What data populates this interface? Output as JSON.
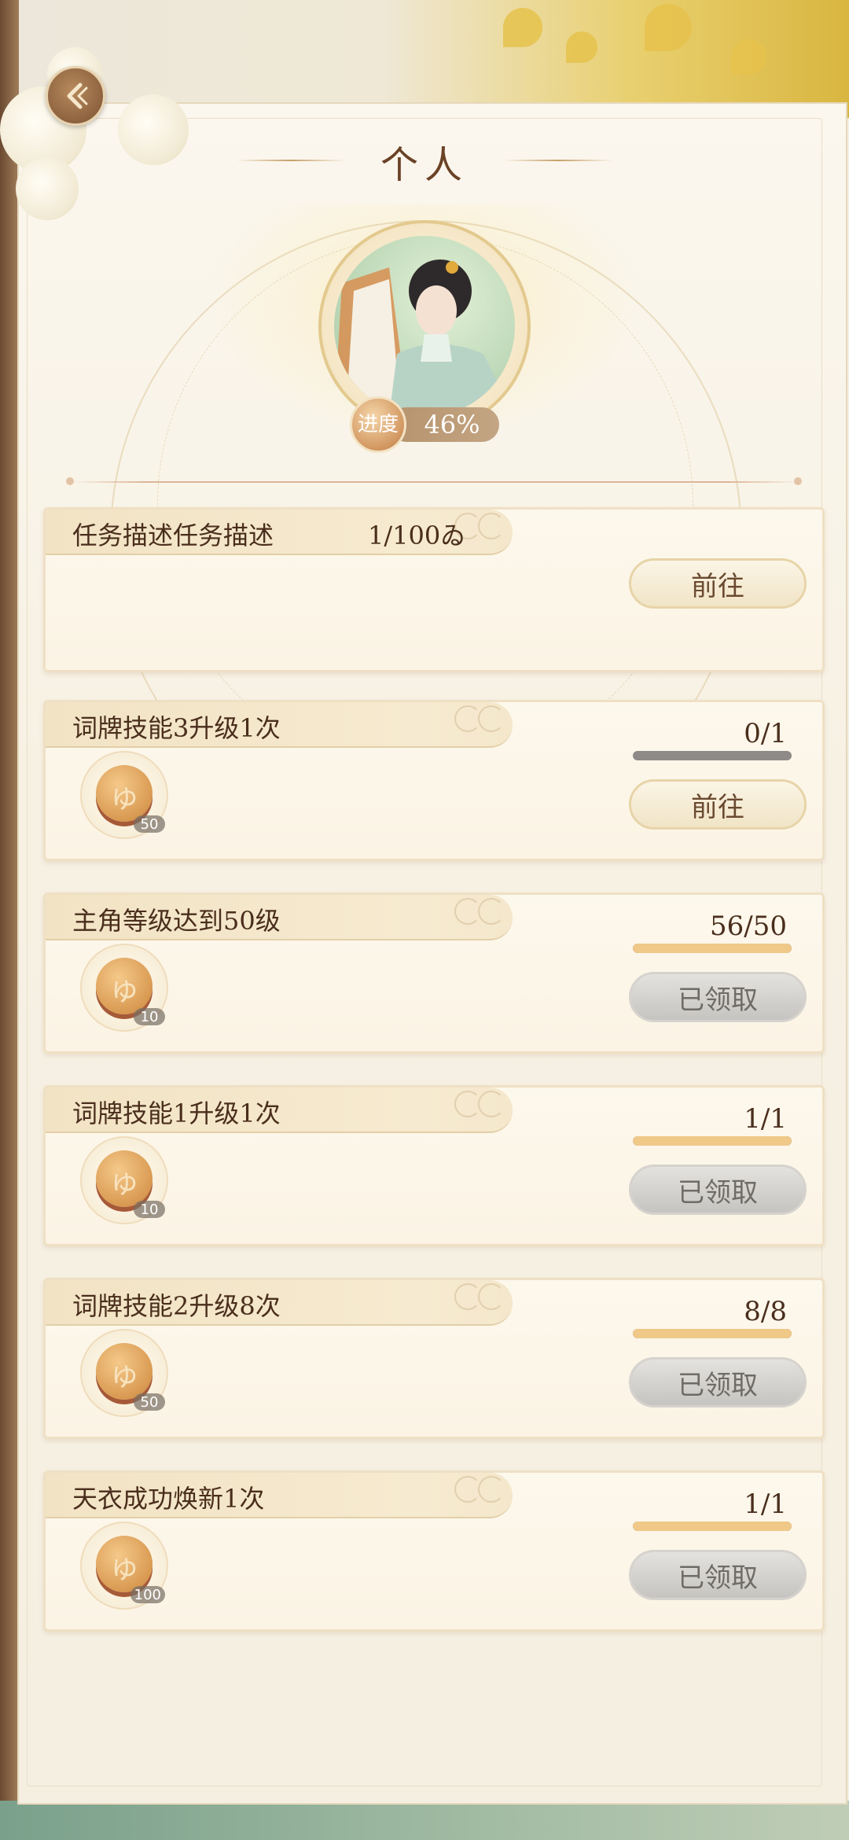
{
  "header": {
    "title": "个人"
  },
  "progress": {
    "badge_label": "进度",
    "value": "46%"
  },
  "tasks": [
    {
      "title": "任务描述任务描述",
      "extra": "1/100ゐ",
      "count": "",
      "progress_fraction": null,
      "reward_amount": "",
      "button": "前往",
      "button_state": "go"
    },
    {
      "title": "词牌技能3升级1次",
      "count": "0/1",
      "progress_fraction": 0,
      "reward_amount": "50",
      "button": "前往",
      "button_state": "go"
    },
    {
      "title": "主角等级达到50级",
      "count": "56/50",
      "progress_fraction": 1,
      "reward_amount": "10",
      "button": "已领取",
      "button_state": "claimed"
    },
    {
      "title": "词牌技能1升级1次",
      "count": "1/1",
      "progress_fraction": 1,
      "reward_amount": "10",
      "button": "已领取",
      "button_state": "claimed"
    },
    {
      "title": "词牌技能2升级8次",
      "count": "8/8",
      "progress_fraction": 1,
      "reward_amount": "50",
      "button": "已领取",
      "button_state": "claimed"
    },
    {
      "title": "天衣成功焕新1次",
      "count": "1/1",
      "progress_fraction": 1,
      "reward_amount": "100",
      "button": "已领取",
      "button_state": "claimed"
    }
  ],
  "colors": {
    "title_text": "#6a4226",
    "task_text": "#4a2e1d",
    "bar_fill": "#f0c888",
    "bar_empty": "#8d8a87"
  }
}
